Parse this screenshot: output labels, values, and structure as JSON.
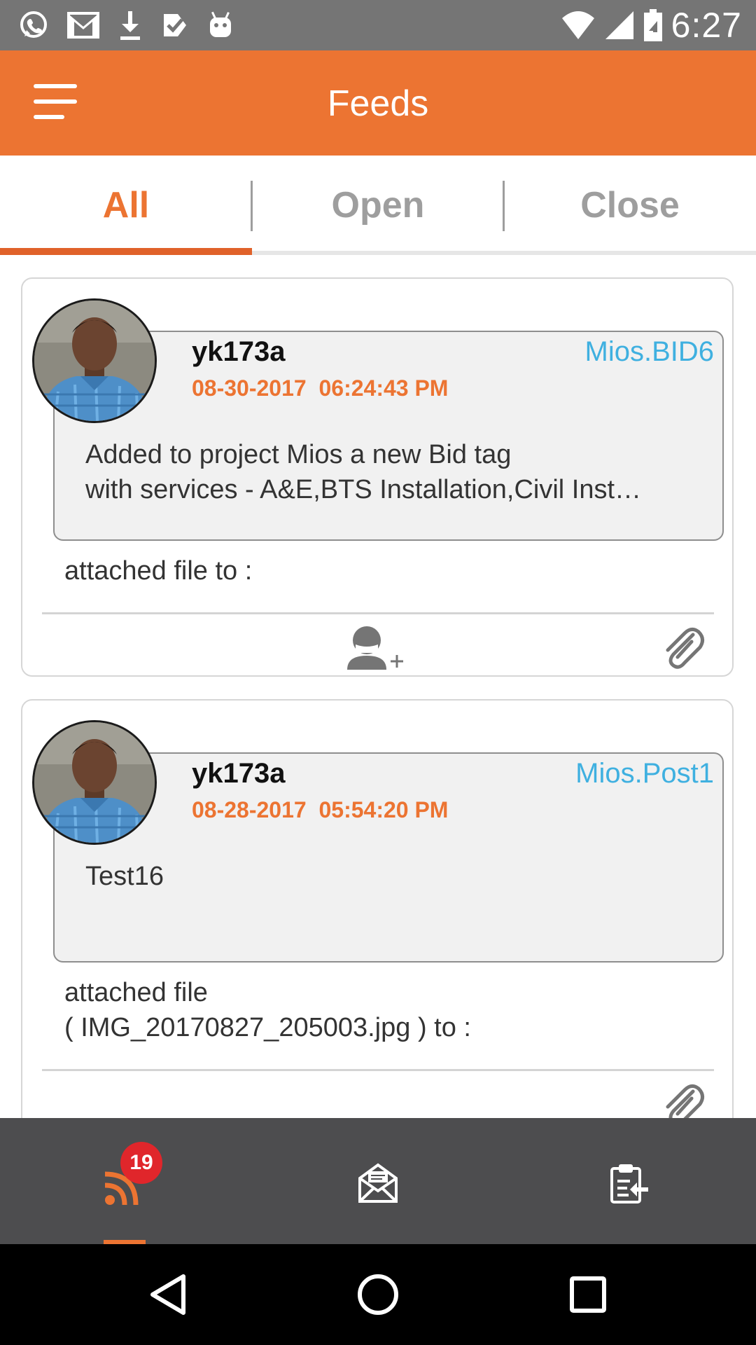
{
  "status_bar": {
    "time": "6:27",
    "left_icons": [
      "whatsapp-icon",
      "gmail-icon",
      "download-icon",
      "task-check-icon",
      "android-icon"
    ],
    "right_icons": [
      "wifi-icon",
      "cell-signal-icon",
      "battery-icon"
    ]
  },
  "app_bar": {
    "title": "Feeds",
    "menu_icon": "hamburger-menu-icon",
    "color": "#ec7432"
  },
  "tabs": {
    "items": [
      {
        "label": "All",
        "active": true
      },
      {
        "label": "Open",
        "active": false
      },
      {
        "label": "Close",
        "active": false
      }
    ]
  },
  "feed": {
    "posts": [
      {
        "user": "yk173a",
        "tag": "Mios.BID6",
        "date": "08-30-2017",
        "time": "06:24:43 PM",
        "message": "Added to project Mios a new Bid tag\nwith services - A&E,BTS Installation,Civil Inst…",
        "attachment_text": "attached file to :",
        "actions": [
          "add-user-icon",
          "paperclip-icon"
        ]
      },
      {
        "user": "yk173a",
        "tag": "Mios.Post1",
        "date": "08-28-2017",
        "time": "05:54:20 PM",
        "message": "Test16",
        "attachment_text": "attached file\n( IMG_20170827_205003.jpg ) to :",
        "actions": [
          "paperclip-icon"
        ]
      }
    ]
  },
  "bottom_nav": {
    "items": [
      {
        "icon": "rss-feed-icon",
        "active": true,
        "badge": "19"
      },
      {
        "icon": "mail-open-icon",
        "active": false
      },
      {
        "icon": "clipboard-import-icon",
        "active": false
      }
    ]
  },
  "system_nav": {
    "buttons": [
      "back-icon",
      "home-icon",
      "recents-icon"
    ]
  },
  "colors": {
    "accent": "#ec7432",
    "tag_link": "#3fb0e0",
    "badge": "#e0262b"
  }
}
